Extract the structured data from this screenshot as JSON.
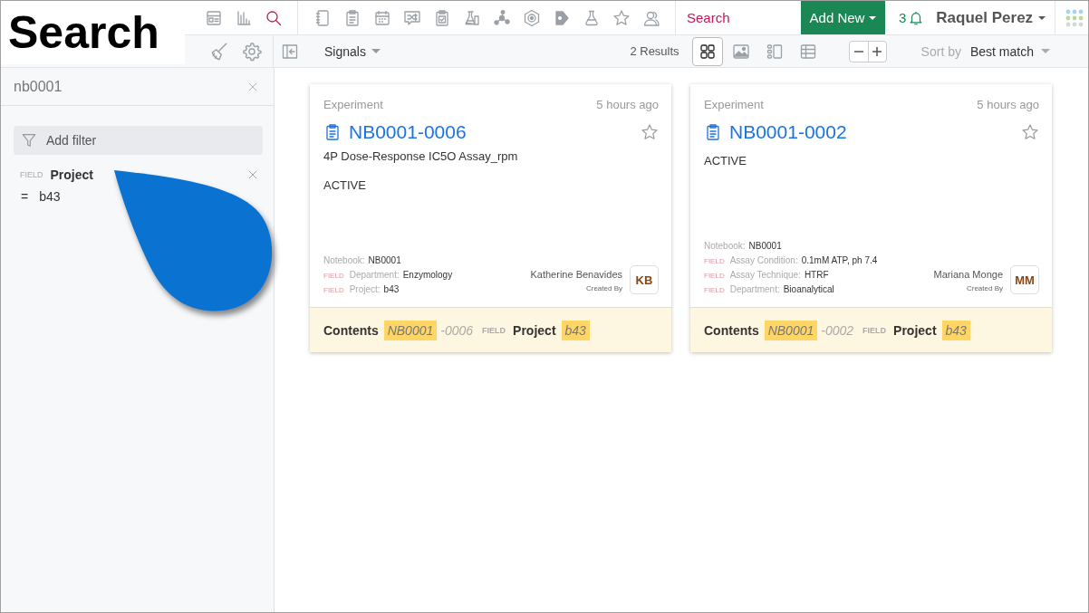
{
  "title_overlay": "Search",
  "nav_icons": [
    {
      "kind": "dashboard",
      "selected": false
    },
    {
      "kind": "chart",
      "selected": false
    },
    {
      "kind": "search",
      "selected": true
    },
    {
      "kind": "divider"
    },
    {
      "kind": "notebook",
      "selected": false
    },
    {
      "kind": "clipboard",
      "selected": false
    },
    {
      "kind": "calendar",
      "selected": false
    },
    {
      "kind": "shuffle",
      "selected": false
    },
    {
      "kind": "checklist",
      "selected": false
    },
    {
      "kind": "flasks",
      "selected": false
    },
    {
      "kind": "molecule",
      "selected": false
    },
    {
      "kind": "hexagon",
      "selected": false
    },
    {
      "kind": "tag",
      "selected": false
    },
    {
      "kind": "flask",
      "selected": false
    },
    {
      "kind": "star",
      "selected": false
    },
    {
      "kind": "people",
      "selected": false
    }
  ],
  "search_box": {
    "placeholder": "Search"
  },
  "add_new": "Add New",
  "notifications": "3",
  "user": "Raquel Perez",
  "toolbar": {
    "source": "Signals",
    "results": "2 Results",
    "views": [
      {
        "kind": "grid",
        "selected": true
      },
      {
        "kind": "image",
        "selected": false
      },
      {
        "kind": "list",
        "selected": false
      },
      {
        "kind": "table",
        "selected": false
      }
    ],
    "sort_label": "Sort by",
    "sort_value": "Best match"
  },
  "sidebar": {
    "query": "nb0001",
    "add_filter": "Add filter",
    "filters": [
      {
        "tag": "FIELD",
        "name": "Project",
        "operator": "=",
        "value": "b43"
      }
    ]
  },
  "cards": [
    {
      "type": "Experiment",
      "time": "5 hours ago",
      "id": "NB0001-0006",
      "starred": false,
      "subtitle": "4P Dose-Response IC5O Assay_rpm",
      "status": "ACTIVE",
      "fields": [
        {
          "label": "Notebook:",
          "value": "NB0001"
        },
        {
          "tag": "FIELD",
          "label": "Department:",
          "value": "Enzymology"
        },
        {
          "tag": "FIELD",
          "label": "Project:",
          "value": "b43"
        }
      ],
      "creator": "Katherine Benavides",
      "created_by": "Created By",
      "initials": "KB",
      "matches": [
        {
          "label": "Contents",
          "parts": [
            {
              "text": "NB0001",
              "highlight": true
            },
            {
              "text": "-0006",
              "highlight": false
            }
          ]
        },
        {
          "tag": "FIELD",
          "label": "Project",
          "parts": [
            {
              "text": "b43",
              "highlight": true
            }
          ]
        }
      ]
    },
    {
      "type": "Experiment",
      "time": "5 hours ago",
      "id": "NB0001-0002",
      "starred": false,
      "status": "ACTIVE",
      "fields": [
        {
          "label": "Notebook:",
          "value": "NB0001"
        },
        {
          "tag": "FIELD",
          "label": "Assay Condition:",
          "value": "0.1mM ATP, ph 7.4"
        },
        {
          "tag": "FIELD",
          "label": "Assay Technique:",
          "value": "HTRF"
        },
        {
          "tag": "FIELD",
          "label": "Department:",
          "value": "Bioanalytical"
        }
      ],
      "creator": "Mariana Monge",
      "created_by": "Created By",
      "initials": "MM",
      "matches": [
        {
          "label": "Contents",
          "parts": [
            {
              "text": "NB0001",
              "highlight": true
            },
            {
              "text": "-0002",
              "highlight": false
            }
          ]
        },
        {
          "tag": "FIELD",
          "label": "Project",
          "parts": [
            {
              "text": "b43",
              "highlight": true
            }
          ]
        }
      ]
    }
  ]
}
